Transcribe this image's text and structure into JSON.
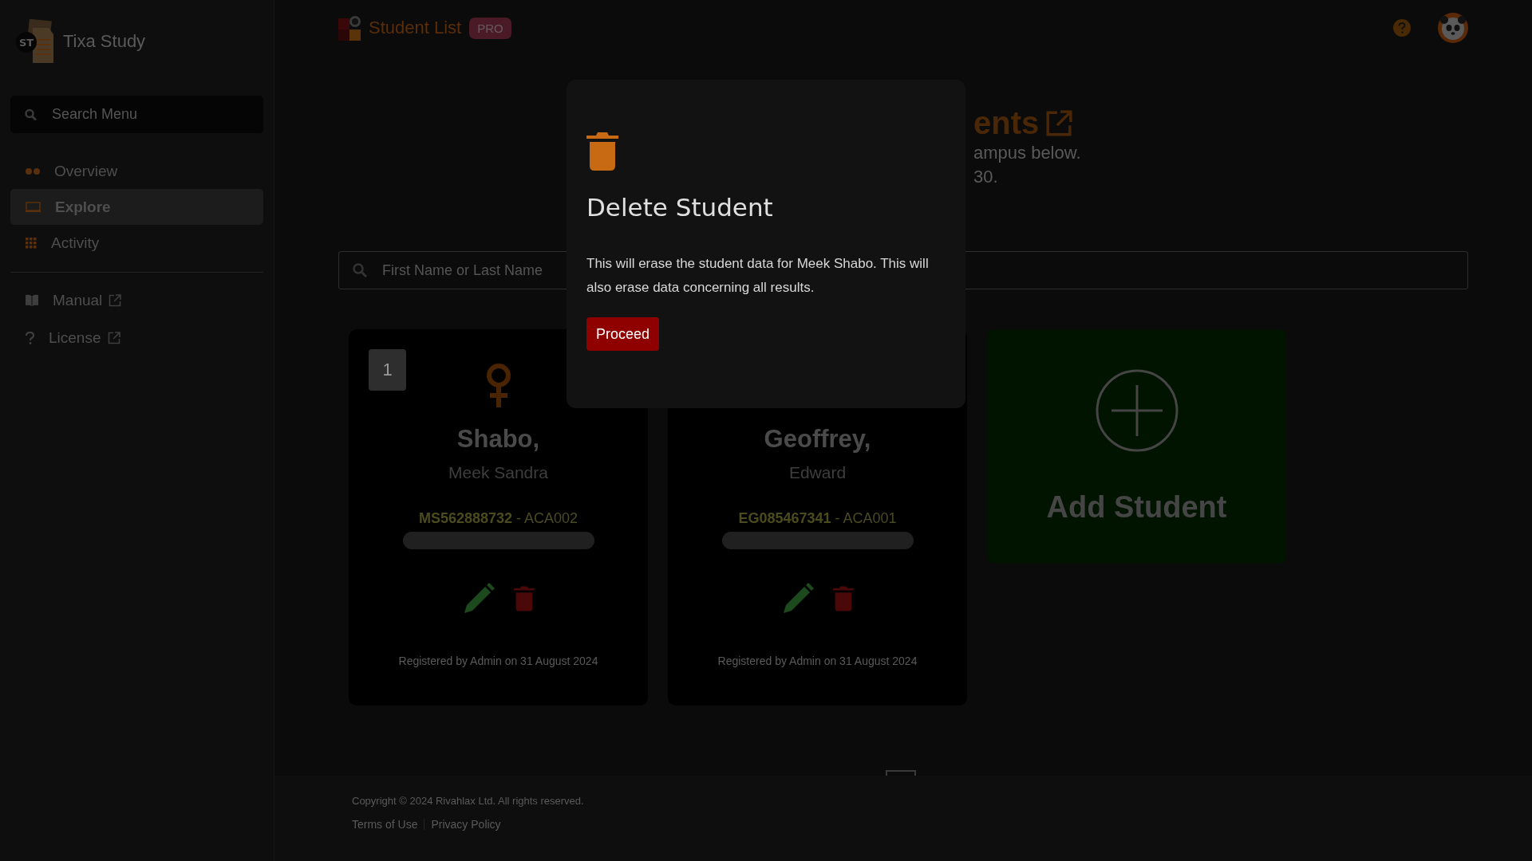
{
  "sidebar": {
    "logo_text": "ST",
    "brand": "Tixa Study",
    "search": {
      "placeholder": "Search Menu"
    },
    "items": [
      {
        "label": "Overview",
        "selected": false
      },
      {
        "label": "Explore",
        "selected": true
      },
      {
        "label": "Activity",
        "selected": false
      }
    ],
    "links": [
      {
        "label": "Manual"
      },
      {
        "label": "License"
      }
    ]
  },
  "header": {
    "title": "Student List",
    "badge": "PRO"
  },
  "page": {
    "heading_fragment": "ents",
    "subtitle_lines": [
      "ampus below.",
      "30."
    ]
  },
  "search": {
    "placeholder": "First Name or Last Name"
  },
  "students": [
    {
      "number": "1",
      "last_name": "Shabo,",
      "first_names": "Meek Sandra",
      "id_line": "**MS562888732** - ACA002",
      "registered": "Registered by Admin on 31 August 2024"
    },
    {
      "last_name": "Geoffrey,",
      "first_names": "Edward",
      "id_line": "**EG085467341** - ACA001",
      "registered": "Registered by Admin on 31 August 2024"
    }
  ],
  "add_card": {
    "label": "Add Student"
  },
  "modal": {
    "title": "Delete Student",
    "message": "This will erase the student data for Meek Shabo. This will also erase data concerning all results.",
    "button": "Proceed"
  },
  "footer": {
    "copyright": "Copyright © 2024 Rivahlax Ltd. All rights reserved.",
    "links": [
      "Terms of Use",
      "Privacy Policy"
    ]
  }
}
